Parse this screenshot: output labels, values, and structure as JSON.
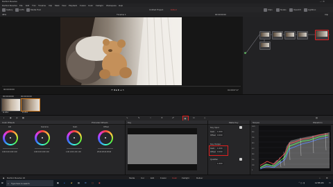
{
  "window": {
    "title": "DaVinci Resolve"
  },
  "menu": {
    "items": [
      "DaVinci Resolve",
      "File",
      "Edit",
      "Trim",
      "Timeline",
      "Clip",
      "Mark",
      "View",
      "Playback",
      "Fusion",
      "Color",
      "Fairlight",
      "Workspace",
      "Help"
    ]
  },
  "toolbar": {
    "project_title": "Untitled Project",
    "project_status": "Edited",
    "timeline_name": "Timeline 1",
    "zoom": "38%",
    "right_label": "Clip",
    "buttons": [
      "Gallery",
      "LUTs",
      "Media Pool",
      "Clips",
      "Nodes",
      "OpenFX",
      "Lightbox"
    ]
  },
  "viewer": {
    "timecode_left": "00:00:00:00",
    "timecode_right": "01:00:07:17"
  },
  "clips": [
    {
      "number": "01",
      "timecode": "00:00:00:00",
      "label": "H.264"
    },
    {
      "number": "02",
      "timecode": "00:00:00:00",
      "label": "H.264"
    }
  ],
  "nodes": [
    {
      "label": "01"
    },
    {
      "label": "02"
    },
    {
      "label": "03"
    },
    {
      "label": "04"
    },
    {
      "label": "05"
    },
    {
      "label": "06"
    }
  ],
  "color_wheels": {
    "panel_title": "Color Wheels",
    "mode": "Primaries Wheels",
    "wheels": [
      {
        "name": "Lift",
        "values": [
          "0.00",
          "0.00",
          "0.00",
          "0.00"
        ]
      },
      {
        "name": "Gamma",
        "values": [
          "0.00",
          "0.00",
          "0.00",
          "0.00"
        ]
      },
      {
        "name": "Gain",
        "values": [
          "1.00",
          "1.00",
          "1.00",
          "1.00"
        ]
      },
      {
        "name": "Offset",
        "values": [
          "25.00",
          "25.00",
          "25.00"
        ]
      }
    ]
  },
  "key_panel": {
    "title": "Key",
    "matte_title": "Matte Key",
    "key_input_label": "Key Input",
    "key_output_label": "Key Output",
    "qualifier_label": "Qualifier",
    "gain_label": "Gain",
    "offset_label": "Offset",
    "key_input_gain": "1.000",
    "key_input_offset": "0.000",
    "key_output_gain": "1.000",
    "key_output_offset": "0.000",
    "qualifier_value": "1.000"
  },
  "scopes": {
    "panel_title": "Scopes",
    "scope_type": "Waveform",
    "ticks": [
      "1023",
      "896",
      "768",
      "640",
      "512",
      "384",
      "256",
      "128",
      "0"
    ]
  },
  "footer": {
    "app_version": "DaVinci Resolve 16"
  },
  "pages": [
    "Media",
    "Cut",
    "Edit",
    "Fusion",
    "Color",
    "Fairlight",
    "Deliver"
  ],
  "taskbar": {
    "search_placeholder": "Type here to search",
    "time": "11:58 AM"
  },
  "colors": {
    "highlight": "#e02020",
    "accent": "#3b82ff"
  }
}
